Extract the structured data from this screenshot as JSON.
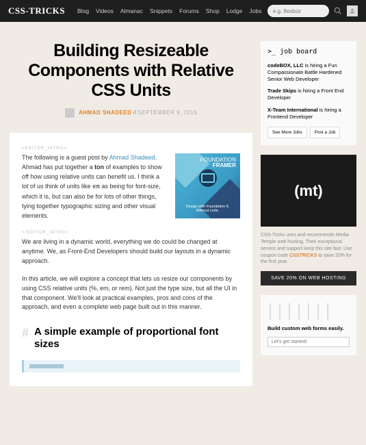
{
  "header": {
    "logo": "CSS-TRICKS",
    "nav": [
      "Blog",
      "Videos",
      "Almanac",
      "Snippets",
      "Forums",
      "Shop",
      "Lodge",
      "Jobs"
    ],
    "search_placeholder": "e.g. flexbox"
  },
  "article": {
    "title": "Building Resizeable Components with Relative CSS Units",
    "author": "AHMAD SHADEED",
    "date": "SEPTEMBER 9, 2016",
    "separator": " // ",
    "editor_tag_open": "<EDITOR_INTRO>",
    "editor_tag_close": "</EDITOR_INTRO>",
    "intro_prefix": "The following is a guest post by ",
    "intro_link": "Ahmad Shadeed",
    "intro_rest": ". Ahmad has put together a ",
    "intro_bold": "ton",
    "intro_after_bold": " of examples to show off how using relative units can benefit us. I think a lot of us think of units like ",
    "intro_code": "em",
    "intro_after_code": " as being for font-size, which it is, but can also be for lots of other things, tying together typographic sizing and other visual elements.",
    "para1": "We are living in a dynamic world, everything we do could be changed at anytime. We, as Front-End Developers should build our layouts in a dynamic approach.",
    "para2": "In this article, we will explore a concept that lets us resize our components by using CSS relative units (%, em, or rem). Not just the type size, but all the UI in that component. We'll look at practical examples, pros and cons of the approach, and even a complete web page built out in this manner.",
    "hash": "#",
    "section1": "A simple example of proportional font sizes"
  },
  "framer": {
    "line1": "FOUNDATION",
    "line2": "FRAMER",
    "sub1": "Design with Foundation 6.",
    "sub2": "Without code."
  },
  "jobboard": {
    "title": ">_ job board",
    "jobs": [
      {
        "company": "codeBOX, LLC",
        "rest": " is hiring a Fun Compassionate Battle Hardened Senior Web Developer"
      },
      {
        "company": "Trade Skips",
        "rest": " is hiring a Front End Developer"
      },
      {
        "company": "X-Team International",
        "rest": " is hiring a Frontend Developer"
      }
    ],
    "btn1": "See More Jobs",
    "btn2": "Post a Job"
  },
  "mt": {
    "logo": "(mt)",
    "text_before": "CSS-Tricks uses and recommends Media Temple web hosting. Their exceptional service and support keep this site fast. Use coupon code ",
    "code": "CSSTRICKS",
    "text_after": " to save 20% for the first year.",
    "cta": "SAVE 20% ON WEB HOSTING"
  },
  "wufoo": {
    "text": "Build custom web forms easily.",
    "placeholder": "Let's get started!"
  }
}
